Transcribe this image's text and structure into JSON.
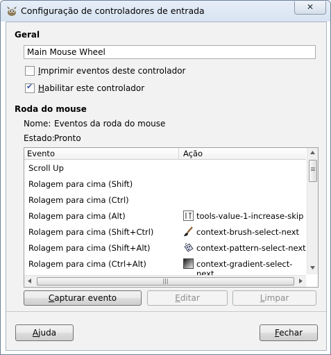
{
  "window": {
    "title": "Configuração de controladores de entrada",
    "close_glyph": "✕"
  },
  "general": {
    "heading": "Geral",
    "name_value": "Main Mouse Wheel",
    "print_events": {
      "mnemonic": "I",
      "rest": "mprimir eventos deste controlador",
      "checked": false
    },
    "enable_controller": {
      "mnemonic": "H",
      "rest": "abilitar este controlador",
      "checked": true
    }
  },
  "wheel": {
    "heading": "Roda do mouse",
    "name_label": "Nome:",
    "name_value": "Eventos da roda do mouse",
    "state_label": "Estado:",
    "state_value": "Pronto"
  },
  "table": {
    "col_event": "Evento",
    "col_action": "Ação",
    "rows": [
      {
        "event": "Scroll Up",
        "action": "",
        "icon": ""
      },
      {
        "event": "Rolagem para cima (Shift)",
        "action": "",
        "icon": ""
      },
      {
        "event": "Rolagem para cima (Ctrl)",
        "action": "",
        "icon": ""
      },
      {
        "event": "Rolagem para cima (Alt)",
        "action": "tools-value-1-increase-skip",
        "icon": "tools-icon"
      },
      {
        "event": "Rolagem para cima (Shift+Ctrl)",
        "action": "context-brush-select-next",
        "icon": "brush-icon"
      },
      {
        "event": "Rolagem para cima (Shift+Alt)",
        "action": "context-pattern-select-next",
        "icon": "pattern-icon"
      },
      {
        "event": "Rolagem para cima (Ctrl+Alt)",
        "action": "context-gradient-select-next",
        "icon": "gradient-icon"
      }
    ]
  },
  "actions": {
    "capture": {
      "mnemonic": "C",
      "rest": "apturar evento"
    },
    "edit": {
      "mnemonic": "E",
      "rest": "ditar"
    },
    "clear": {
      "mnemonic": "L",
      "rest": "impar"
    }
  },
  "footer": {
    "help": {
      "mnemonic": "A",
      "rest": "juda"
    },
    "close": {
      "mnemonic": "F",
      "rest": "echar"
    }
  },
  "scrollbar": {
    "grip": "|||"
  },
  "colors": {
    "accent": "#3a5aa8",
    "titlebar": "#d7e3f1"
  }
}
